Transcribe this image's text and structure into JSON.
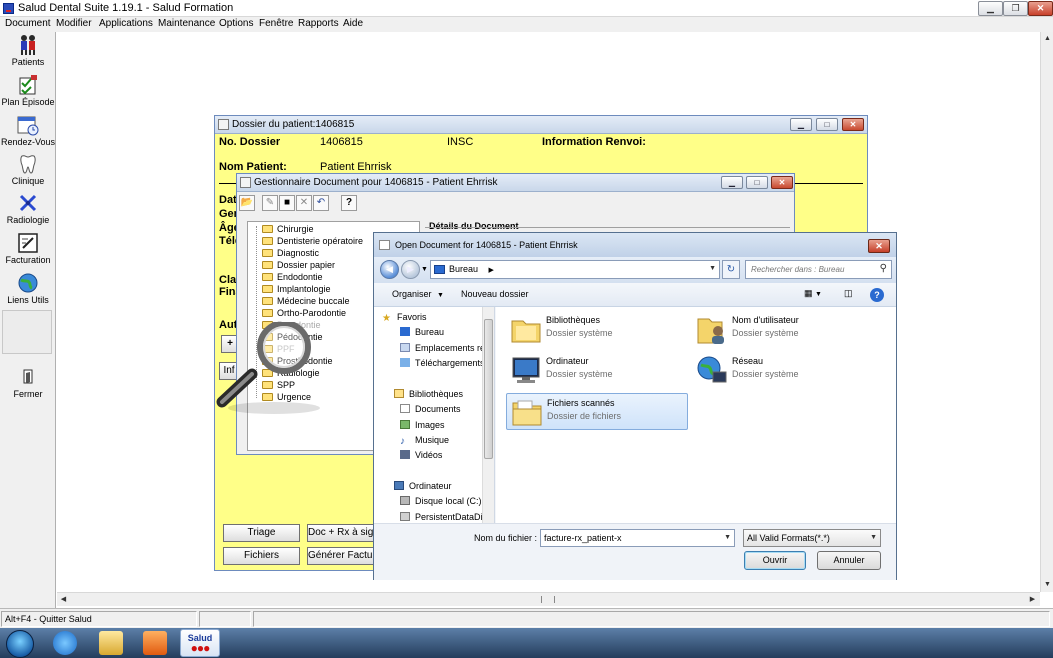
{
  "app": {
    "title": "Salud Dental Suite 1.19.1 - Salud Formation",
    "menu": [
      "Document",
      "Modifier",
      "Applications",
      "Maintenance",
      "Options",
      "Fenêtre",
      "Rapports",
      "Aide"
    ]
  },
  "launcher": {
    "items": [
      {
        "label": "Patients",
        "icon": "patients-icon"
      },
      {
        "label": "Plan Épisode",
        "icon": "plan-episode-icon"
      },
      {
        "label": "Rendez-Vous",
        "icon": "calendar-icon"
      },
      {
        "label": "Clinique",
        "icon": "tooth-icon"
      },
      {
        "label": "Radiologie",
        "icon": "xray-icon"
      },
      {
        "label": "Facturation",
        "icon": "invoice-icon"
      },
      {
        "label": "Liens Utils",
        "icon": "globe-icon"
      }
    ],
    "close_label": "Fermer"
  },
  "status": {
    "hint": "Alt+F4 - Quitter Salud"
  },
  "taskbar": {
    "salud_label": "Salud",
    "salud_dots": "●●●"
  },
  "dossier": {
    "title": "Dossier du patient:1406815",
    "no_dossier_label": "No. Dossier",
    "no_dossier_value": "1406815",
    "insc_label": "INSC",
    "info_renvoi_label": "Information Renvoi:",
    "nom_patient_label": "Nom Patient:",
    "nom_patient_value": "Patient Ehrrisk",
    "left_labels": [
      "Dat",
      "Gen",
      "Âge",
      "Télé",
      "Clas",
      "Fina",
      "Aut"
    ],
    "add_symbol": "+",
    "inf_label": "Inf",
    "buttons": {
      "triage": "Triage",
      "doc_rx": "Doc + Rx à signer",
      "fichiers": "Fichiers",
      "generer": "Générer Facture"
    }
  },
  "gestionnaire": {
    "title": "Gestionnaire Document pour 1406815 - Patient Ehrrisk",
    "details_heading": "Détails du Document",
    "tree": [
      "Chirurgie",
      "Dentisterie opératoire",
      "Diagnostic",
      "Dossier papier",
      "Endodontie",
      "Implantologie",
      "Médecine buccale",
      "Ortho-Parodontie",
      "Parodontie",
      "Pédodontie",
      "PPF",
      "Prosthodontie",
      "Radiologie",
      "SPP",
      "Urgence"
    ]
  },
  "open_dialog": {
    "title": "Open Document for 1406815 - Patient Ehrrisk",
    "address": "Bureau",
    "search_placeholder": "Rechercher dans : Bureau",
    "organize_label": "Organiser",
    "new_folder_label": "Nouveau dossier",
    "nav": [
      {
        "label": "Favoris",
        "group": true
      },
      {
        "label": "Bureau",
        "group": false
      },
      {
        "label": "Emplacements ré",
        "group": false
      },
      {
        "label": "Téléchargements",
        "group": false
      },
      {
        "label": "Bibliothèques",
        "group": true
      },
      {
        "label": "Documents",
        "group": false
      },
      {
        "label": "Images",
        "group": false
      },
      {
        "label": "Musique",
        "group": false
      },
      {
        "label": "Vidéos",
        "group": false
      },
      {
        "label": "Ordinateur",
        "group": true
      },
      {
        "label": "Disque local (C:)",
        "group": false
      },
      {
        "label": "PersistentDataDis",
        "group": false
      }
    ],
    "files": [
      {
        "name": "Bibliothèques",
        "type": "Dossier système",
        "icon": "libraries-icon"
      },
      {
        "name": "Nom d'utilisateur",
        "type": "Dossier système",
        "icon": "user-folder-icon"
      },
      {
        "name": "Ordinateur",
        "type": "Dossier système",
        "icon": "computer-icon"
      },
      {
        "name": "Réseau",
        "type": "Dossier système",
        "icon": "network-icon"
      },
      {
        "name": "Fichiers scannés",
        "type": "Dossier de fichiers",
        "icon": "folder-icon"
      }
    ],
    "filename_label": "Nom du fichier :",
    "filename_value": "facture-rx_patient-x",
    "filter_value": "All Valid Formats(*.*)",
    "open_button": "Ouvrir",
    "cancel_button": "Annuler"
  }
}
